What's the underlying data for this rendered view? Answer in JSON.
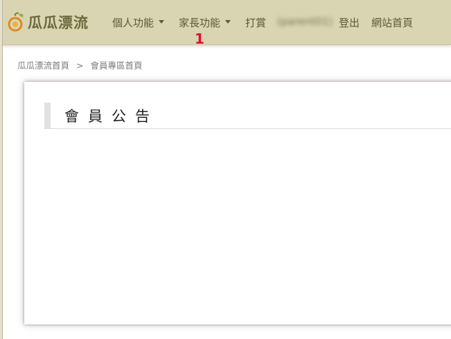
{
  "brand": {
    "logo_text": "瓜瓜漂流",
    "logo_icon": "gourd-icon"
  },
  "nav": {
    "personal": "個人功能",
    "parent": "家長功能",
    "donate": "打賞",
    "username": "(parent01)",
    "logout": "登出",
    "home": "網站首頁"
  },
  "marker": "1",
  "breadcrumb": {
    "home": "瓜瓜漂流首頁",
    "separator": ">",
    "current": "會員專區首頁"
  },
  "panel": {
    "title": "會員公告"
  },
  "colors": {
    "navbar_bg": "#d9d4b2",
    "nav_text": "#5b5838",
    "marker": "#e0102a"
  }
}
